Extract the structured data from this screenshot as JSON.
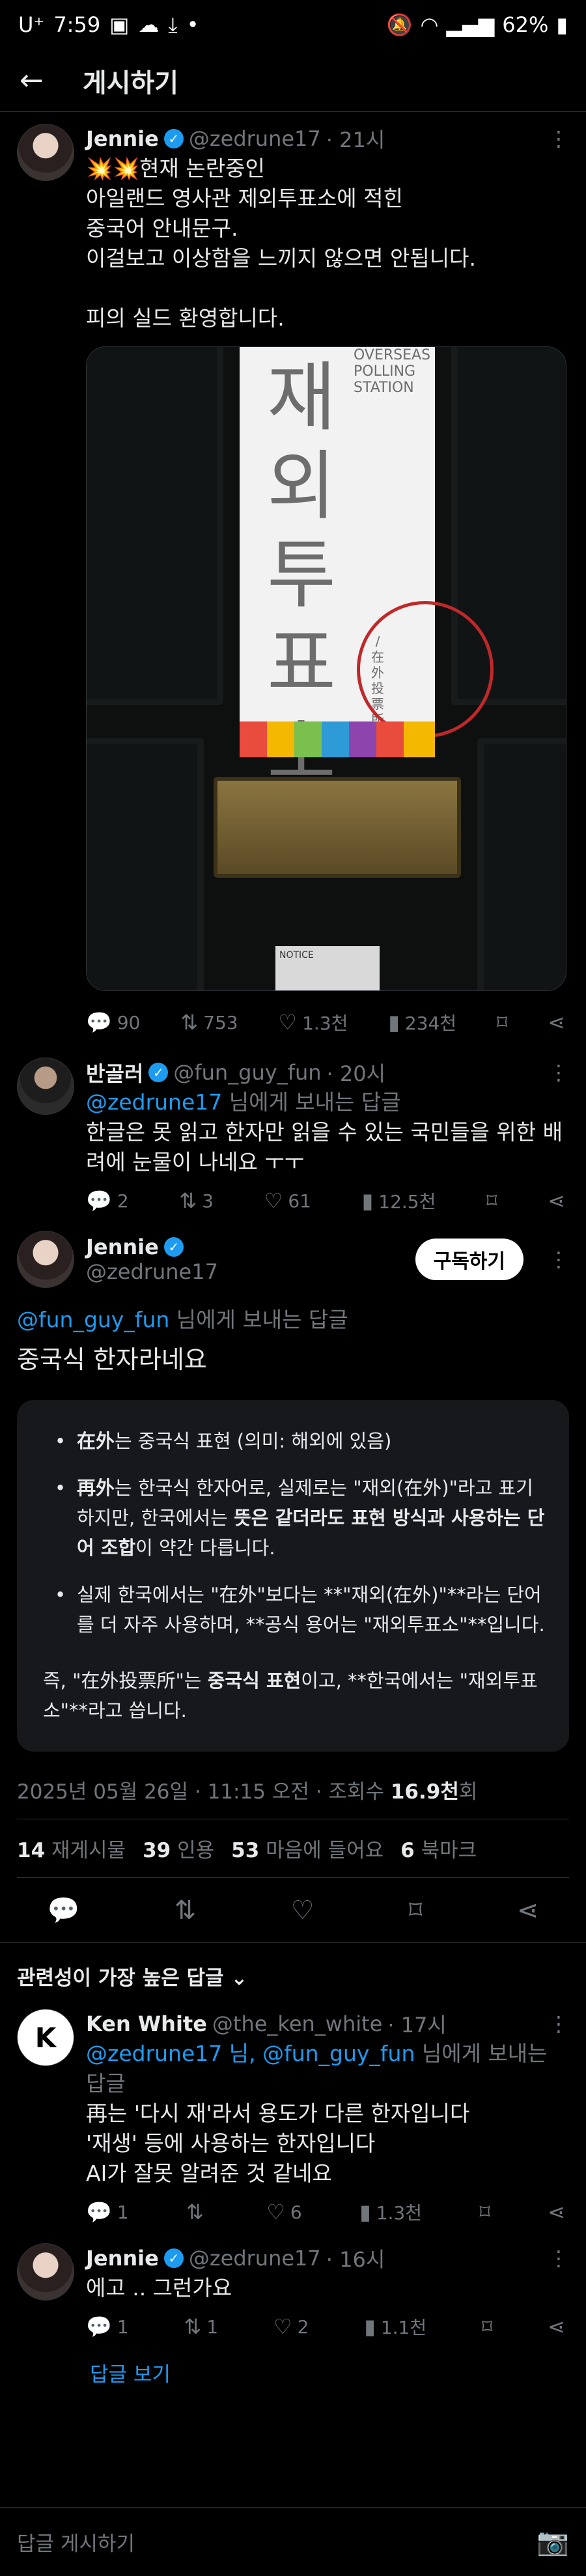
{
  "status_bar": {
    "carrier": "U⁺",
    "time": "7:59",
    "battery": "62%"
  },
  "header": {
    "title": "게시하기"
  },
  "post1": {
    "name": "Jennie",
    "handle": "@zedrune17",
    "time": "· 21시",
    "text": "💥💥현재 논란중인\n아일랜드 영사관 제외투표소에 적힌\n중국어 안내문구.\n이걸보고 이상함을 느끼지 않으면 안됩니다.\n\n피의 실드 환영합니다.",
    "image": {
      "sign_korean": "재외투표소",
      "sign_english": "OVERSEAS POLLING STATION",
      "sign_chinese": "/在外投票所",
      "notice": "NOTICE"
    },
    "stats": {
      "replies": "90",
      "reposts": "753",
      "likes": "1.3천",
      "views": "234천"
    }
  },
  "reply1": {
    "name": "반골러",
    "handle": "@fun_guy_fun",
    "time": "· 20시",
    "reply_to_handle": "@zedrune17",
    "reply_to_suffix": " 님에게 보내는 답글",
    "text": "한글은 못 읽고 한자만 읽을 수 있는 국민들을 위한 배려에 눈물이 나네요 ㅜㅜ",
    "stats": {
      "replies": "2",
      "reposts": "3",
      "likes": "61",
      "views": "12.5천"
    }
  },
  "main": {
    "name": "Jennie",
    "handle": "@zedrune17",
    "follow": "구독하기",
    "reply_to_handle": "@fun_guy_fun",
    "reply_to_suffix": " 님에게 보내는 답글",
    "text": "중국식 한자라네요",
    "ai": {
      "b1_bold": "在外",
      "b1_rest": "는 중국식 표현 (의미: 해외에 있음)",
      "b2_bold1": "再外",
      "b2_rest1": "는 한국식 한자어로, 실제로는 \"재외(在外)\"라고 표기하지만, 한국에서는 ",
      "b2_bold2": "뜻은 같더라도 표현 방식과 사용하는 단어 조합",
      "b2_rest2": "이 약간 다릅니다.",
      "b3": "실제 한국에서는 \"在外\"보다는 **\"재외(在外)\"**라는 단어를 더 자주 사용하며, **공식 용어는 \"재외투표소\"**입니다.",
      "s_pre": "즉, \"在外投票所\"는 ",
      "s_bold": "중국식 표현",
      "s_post": "이고, **한국에서는 \"재외투표소\"**라고 씁니다."
    },
    "meta_date": "2025년 05월 26일 · 11:15 오전 · 조회수 ",
    "meta_views": "16.9천",
    "meta_unit": "회",
    "reposts": "14",
    "reposts_label": "재게시물",
    "quotes": "39",
    "quotes_label": "인용",
    "likes": "53",
    "likes_label": "마음에 들어요",
    "bookmarks": "6",
    "bookmarks_label": "북마크"
  },
  "sort_label": "관련성이 가장 높은 답글",
  "reply2": {
    "name": "Ken White",
    "handle": "@the_ken_white",
    "time": "· 17시",
    "reply_to_handles": "@zedrune17 님, @fun_guy_fun",
    "reply_to_suffix": " 님에게 보내는 답글",
    "text": "再는 '다시 재'라서 용도가 다른 한자입니다\n'재생' 등에 사용하는 한자입니다\nAI가 잘못 알려준 것 같네요",
    "stats": {
      "replies": "1",
      "reposts": "",
      "likes": "6",
      "views": "1.3천"
    }
  },
  "reply3": {
    "name": "Jennie",
    "handle": "@zedrune17",
    "time": "· 16시",
    "text": "에고 .. 그런가요",
    "stats": {
      "replies": "1",
      "reposts": "1",
      "likes": "2",
      "views": "1.1천"
    }
  },
  "show_replies": "답글 보기",
  "compose_placeholder": "답글 게시하기"
}
